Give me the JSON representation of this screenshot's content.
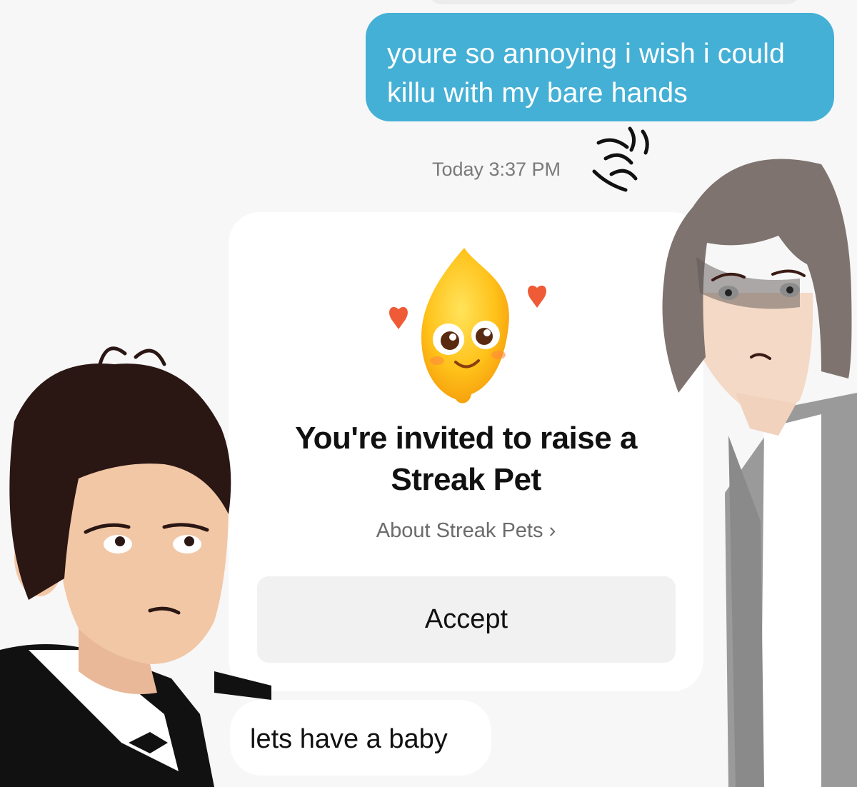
{
  "sent_message": {
    "text": "youre so annoying i wish i could\nkillu with my bare hands"
  },
  "timestamp": "Today 3:37 PM",
  "invite_card": {
    "title": "You're invited to raise a\nStreak Pet",
    "about_link": "About Streak Pets",
    "chevron": "›",
    "accept_label": "Accept",
    "pet_icon": "streak-pet-flame-icon"
  },
  "received_message": {
    "text": "lets have a baby"
  },
  "colors": {
    "sent_bubble": "#45b0d6",
    "background": "#f7f7f7",
    "card": "#ffffff",
    "button": "#f1f1f1"
  }
}
